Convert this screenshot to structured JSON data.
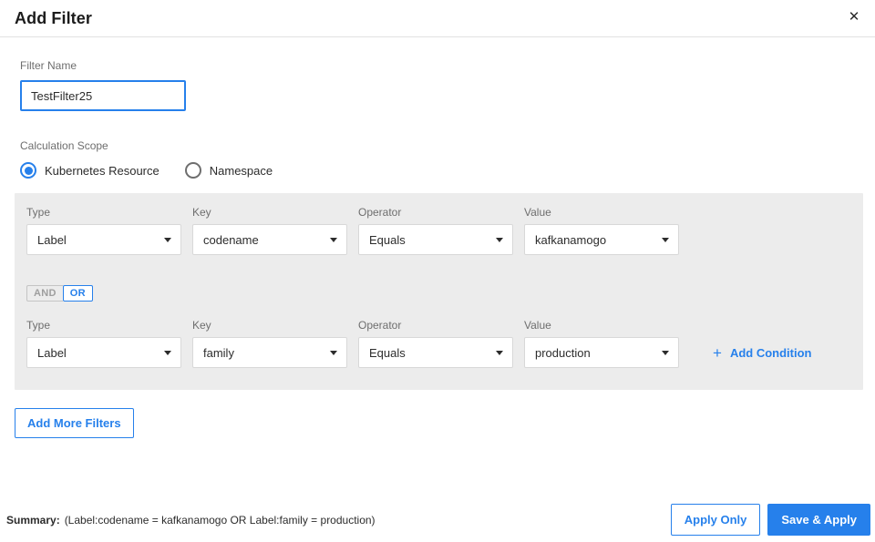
{
  "dialog": {
    "title": "Add Filter",
    "close_icon": "✕"
  },
  "filter_name": {
    "label": "Filter Name",
    "value": "TestFilter25"
  },
  "calculation_scope": {
    "label": "Calculation Scope",
    "options": [
      {
        "label": "Kubernetes Resource",
        "selected": true
      },
      {
        "label": "Namespace",
        "selected": false
      }
    ]
  },
  "conditions": {
    "rows": [
      {
        "fields": [
          {
            "label": "Type",
            "value": "Label"
          },
          {
            "label": "Key",
            "value": "codename"
          },
          {
            "label": "Operator",
            "value": "Equals"
          },
          {
            "label": "Value",
            "value": "kafkanamogo"
          }
        ]
      },
      {
        "fields": [
          {
            "label": "Type",
            "value": "Label"
          },
          {
            "label": "Key",
            "value": "family"
          },
          {
            "label": "Operator",
            "value": "Equals"
          },
          {
            "label": "Value",
            "value": "production"
          }
        ]
      }
    ],
    "logic_toggle": {
      "and_label": "AND",
      "or_label": "OR",
      "selected": "OR"
    },
    "add_condition": {
      "plus_icon": "+",
      "label": "Add Condition"
    }
  },
  "actions": {
    "add_more_filters": "Add More Filters",
    "apply_only": "Apply Only",
    "save_and_apply": "Save & Apply"
  },
  "summary": {
    "label": "Summary:",
    "text": "(Label:codename = kafkanamogo OR Label:family = production)"
  },
  "colors": {
    "accent_blue": "#2680eb",
    "panel_gray": "#ececec",
    "label_gray": "#6e6e6e"
  }
}
